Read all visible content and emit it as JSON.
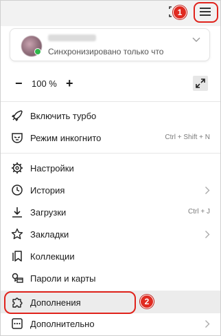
{
  "account": {
    "status": "Синхронизировано только что"
  },
  "zoom": {
    "minus": "−",
    "value": "100 %",
    "plus": "+"
  },
  "annotations": {
    "badge_1": "1",
    "badge_2": "2",
    "highlight_color": "#e0221b"
  },
  "menu": {
    "group1": [
      {
        "label": "Включить турбо",
        "icon": "rocket-icon"
      },
      {
        "label": "Режим инкогнито",
        "icon": "incognito-mask-icon",
        "shortcut": "Ctrl + Shift + N"
      }
    ],
    "group2": [
      {
        "label": "Настройки",
        "icon": "gear-icon"
      },
      {
        "label": "История",
        "icon": "clock-icon",
        "submenu": true
      },
      {
        "label": "Загрузки",
        "icon": "download-icon",
        "shortcut": "Ctrl + J"
      },
      {
        "label": "Закладки",
        "icon": "star-icon",
        "submenu": true
      },
      {
        "label": "Коллекции",
        "icon": "bookmark-collection-icon"
      },
      {
        "label": "Пароли и карты",
        "icon": "key-card-icon"
      },
      {
        "label": "Дополнения",
        "icon": "puzzle-icon",
        "active": true
      },
      {
        "label": "Дополнительно",
        "icon": "more-dots-icon",
        "submenu": true
      }
    ]
  }
}
